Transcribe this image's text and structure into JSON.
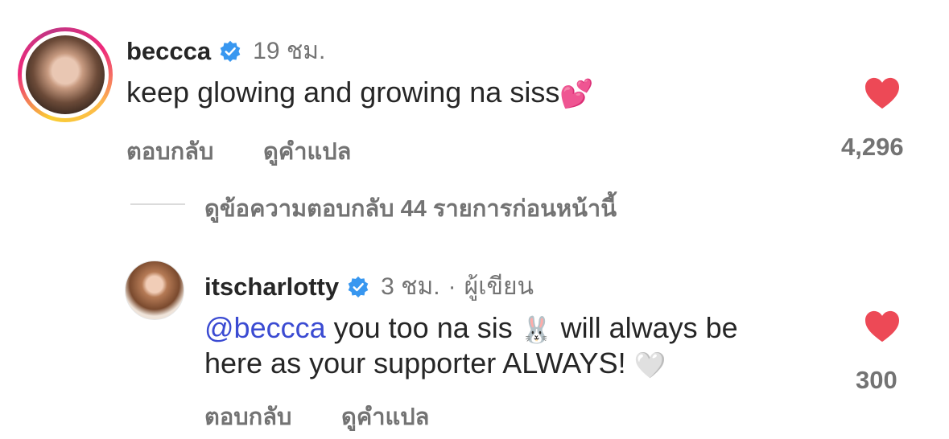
{
  "comment": {
    "username": "beccca",
    "time": "19 ชม.",
    "text": "keep glowing and growing na siss",
    "emoji": "💕",
    "reply_label": "ตอบกลับ",
    "translate_label": "ดูคำแปล",
    "like_count": "4,296"
  },
  "view_replies_label": "ดูข้อความตอบกลับ 44 รายการก่อนหน้านี้",
  "reply": {
    "username": "itscharlotty",
    "time": "3 ชม.",
    "separator": "·",
    "author_badge": "ผู้เขียน",
    "mention": "@beccca",
    "text_line1": " you too na sis ",
    "emoji_rabbit": "🐰",
    "text_line1_end": " will always be",
    "text_line2": "here as your supporter ALWAYS! ",
    "emoji_heart": "🤍",
    "reply_label": "ตอบกลับ",
    "translate_label": "ดูคำแปล",
    "like_count": "300"
  },
  "colors": {
    "like_active": "#ed4956",
    "verified": "#3897f0",
    "mention": "#3b4bd2",
    "secondary_text": "#737373"
  }
}
